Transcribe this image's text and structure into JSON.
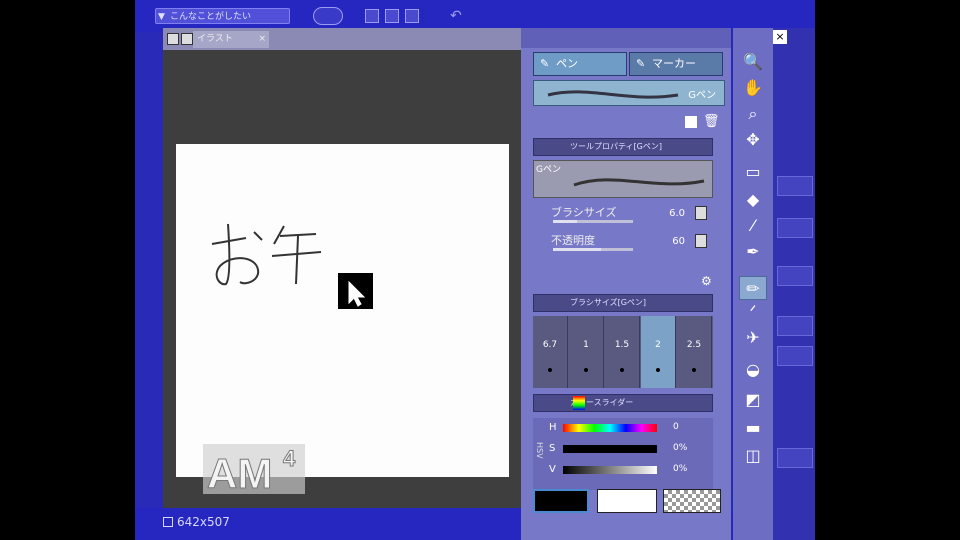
{
  "header": {
    "search_text": "こんなことがしたい",
    "search_glyph": "▼"
  },
  "canvas": {
    "tab_label": "イラスト",
    "size_label": "642x507",
    "drawn_text": "お午"
  },
  "tool_panel": {
    "pen_tab": "ペン",
    "marker_tab": "マーカー",
    "selected_brush": "Gペン"
  },
  "tool_property": {
    "header": "ツールプロパティ[Gペン]",
    "preview_label": "Gペン",
    "brush_size_label": "ブラシサイズ",
    "brush_size_value": "6.0",
    "opacity_label": "不透明度",
    "opacity_value": "60",
    "brush_size_fraction": 0.3,
    "opacity_fraction": 0.6
  },
  "brush_size_panel": {
    "header": "ブラシサイズ[Gペン]",
    "sizes": [
      "6.7",
      "1",
      "1.5",
      "2",
      "2.5"
    ],
    "selected_index": 3
  },
  "color_slider": {
    "header": "カラースライダー",
    "h_label": "H",
    "s_label": "S",
    "v_label": "V",
    "h_value": "0",
    "s_value": "0%",
    "v_value": "0%",
    "side_label": "HSV"
  },
  "colors": {
    "main": "#000000",
    "sub": "#ffffff"
  },
  "watermark": "AM4",
  "tools": [
    "zoom-icon",
    "hand-icon",
    "magnifier-icon",
    "move-icon",
    "selection-icon",
    "operation-icon",
    "eyedropper-icon",
    "pen-icon",
    "pencil-icon",
    "brush-icon",
    "airbrush-icon",
    "fill-icon",
    "gradient-icon",
    "shape-icon",
    "eraser-icon"
  ]
}
